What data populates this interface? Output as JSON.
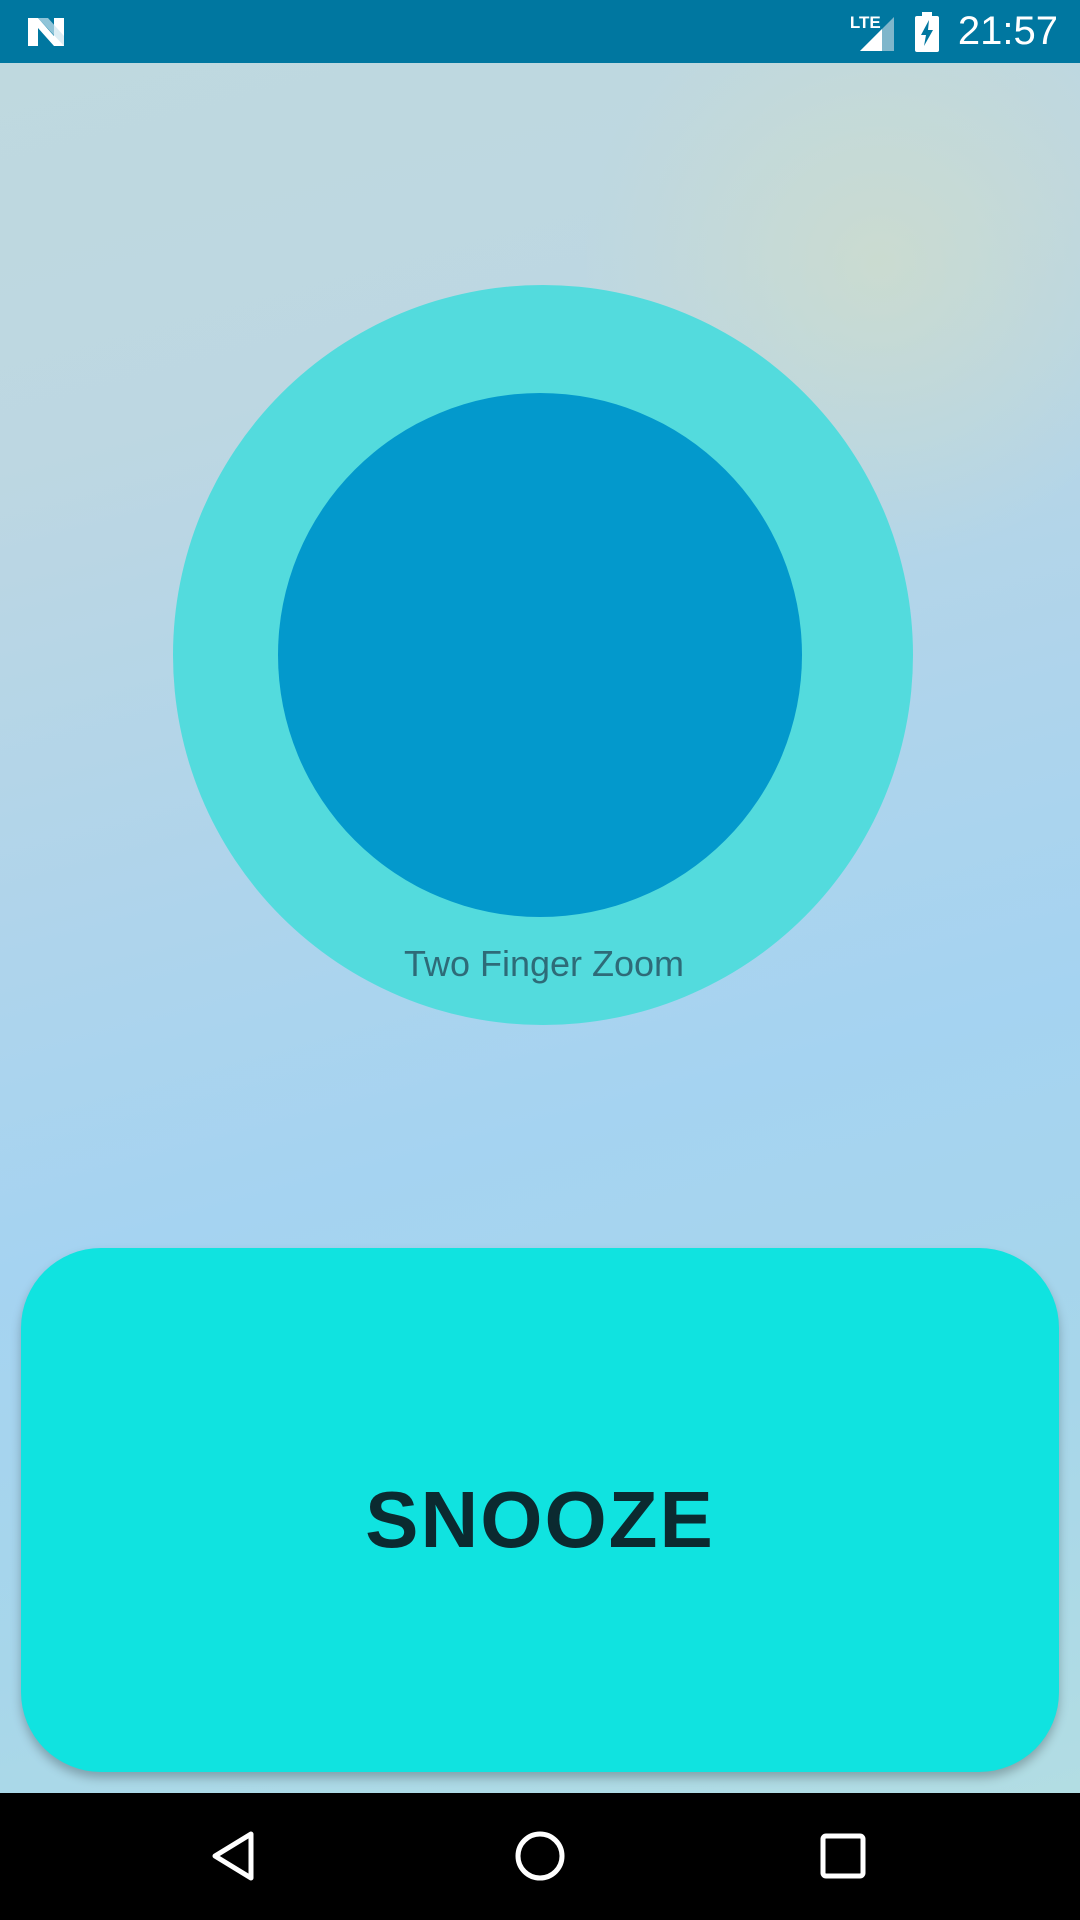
{
  "status_bar": {
    "time": "21:57",
    "network": "LTE",
    "icons": [
      "notification-n-icon",
      "lte-signal-icon",
      "battery-charging-icon"
    ]
  },
  "main": {
    "zoom_label": "Two Finger Zoom",
    "snooze_label": "SNOOZE"
  },
  "nav_bar": {
    "icons": [
      "back-icon",
      "home-icon",
      "recents-icon"
    ]
  },
  "colors": {
    "status_bar": "#0077a0",
    "outer_circle": "#53dbdd",
    "inner_circle": "#0399cc",
    "snooze_button": "#10e3e0"
  }
}
